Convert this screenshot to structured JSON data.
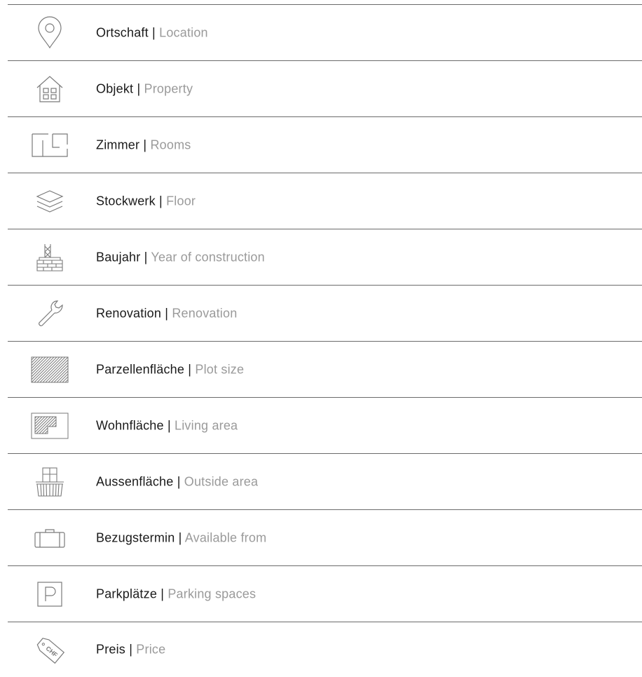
{
  "colors": {
    "divider": "#6b6b6b",
    "icon_stroke": "#7a7a7a",
    "label_primary": "#1a1a1a",
    "label_secondary": "#9a9a9a"
  },
  "separator": "|",
  "rows": [
    {
      "de": "Ortschaft",
      "en": "Location",
      "icon": "location-pin-icon"
    },
    {
      "de": "Objekt",
      "en": "Property",
      "icon": "house-icon"
    },
    {
      "de": "Zimmer",
      "en": "Rooms",
      "icon": "floorplan-rooms-icon"
    },
    {
      "de": "Stockwerk",
      "en": "Floor",
      "icon": "layers-icon"
    },
    {
      "de": "Baujahr",
      "en": "Year of construction",
      "icon": "construction-bricks-icon"
    },
    {
      "de": "Renovation",
      "en": "Renovation",
      "icon": "wrench-icon"
    },
    {
      "de": "Parzellenfläche",
      "en": "Plot size",
      "icon": "hatched-plot-icon"
    },
    {
      "de": "Wohnfläche",
      "en": "Living area",
      "icon": "living-area-icon"
    },
    {
      "de": "Aussenfläche",
      "en": "Outside area",
      "icon": "balcony-icon"
    },
    {
      "de": "Bezugstermin",
      "en": "Available from",
      "icon": "suitcase-icon"
    },
    {
      "de": "Parkplätze",
      "en": "Parking spaces",
      "icon": "parking-icon"
    },
    {
      "de": "Preis",
      "en": "Price",
      "icon": "price-tag-icon",
      "icon_text": "CHF"
    }
  ]
}
